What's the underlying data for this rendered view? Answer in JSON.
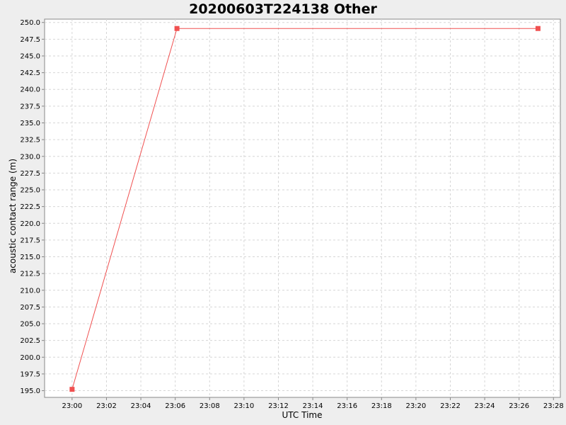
{
  "chart_data": {
    "type": "line",
    "title": "20200603T224138 Other",
    "xlabel": "UTC Time",
    "ylabel": "acoustic contact range (m)",
    "grid": true,
    "legend": "none",
    "ylim": [
      194.0,
      250.5
    ],
    "xlim": [
      "22:58:24",
      "23:28:24"
    ],
    "x_ticks": [
      "23:00",
      "23:02",
      "23:04",
      "23:06",
      "23:08",
      "23:10",
      "23:12",
      "23:14",
      "23:16",
      "23:18",
      "23:20",
      "23:22",
      "23:24",
      "23:26",
      "23:28"
    ],
    "y_ticks": [
      "195.0",
      "197.5",
      "200.0",
      "202.5",
      "205.0",
      "207.5",
      "210.0",
      "212.5",
      "215.0",
      "217.5",
      "220.0",
      "222.5",
      "225.0",
      "227.5",
      "230.0",
      "232.5",
      "235.0",
      "237.5",
      "240.0",
      "242.5",
      "245.0",
      "247.5",
      "250.0"
    ],
    "series": [
      {
        "color": "#f05050",
        "marker": "square",
        "x": [
          "23:00:00",
          "23:06:06",
          "23:27:06"
        ],
        "values": [
          195.2,
          249.1,
          249.1
        ]
      }
    ]
  }
}
